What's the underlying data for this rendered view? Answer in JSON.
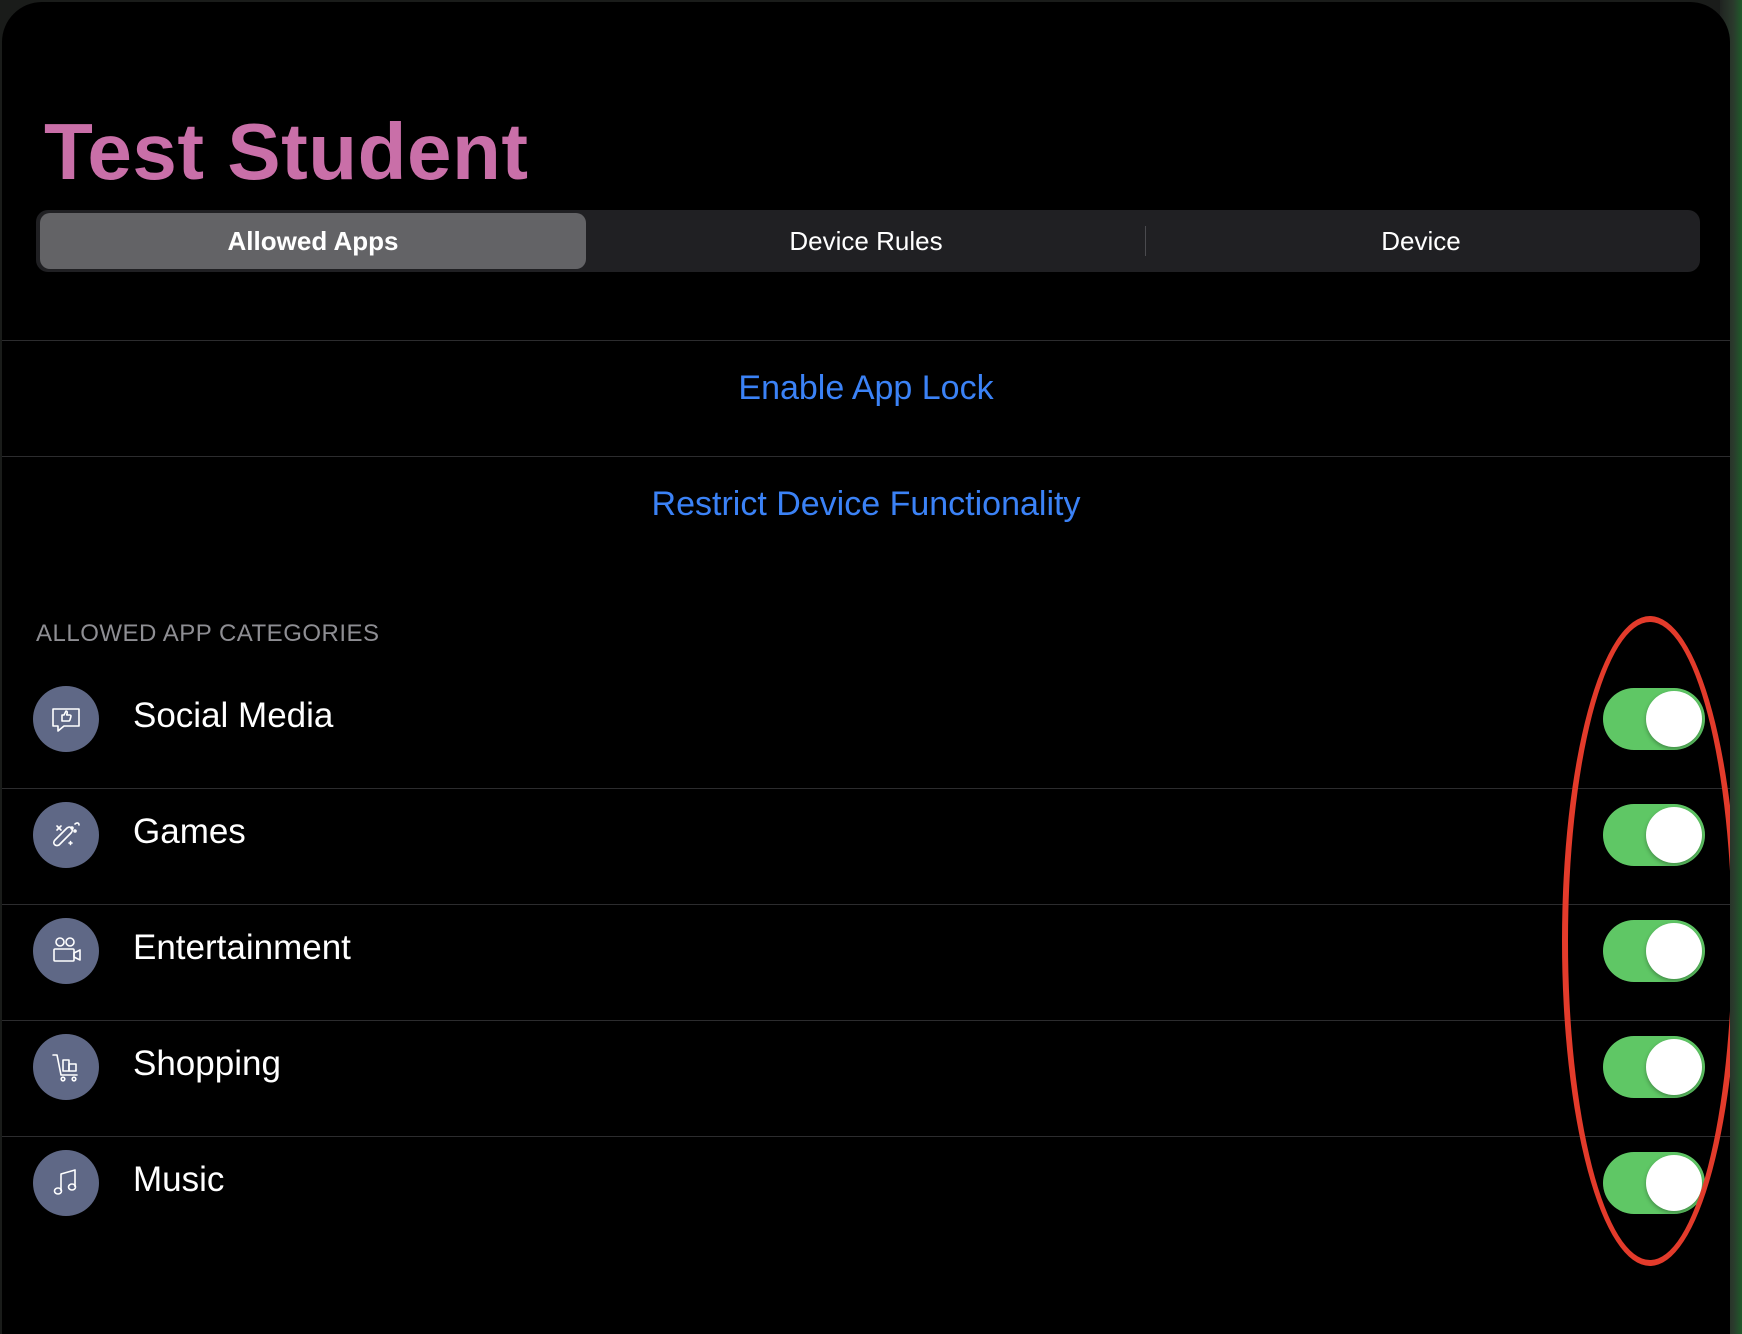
{
  "header": {
    "title": "Test Student"
  },
  "tabs": [
    {
      "label": "Allowed Apps",
      "selected": true
    },
    {
      "label": "Device Rules",
      "selected": false
    },
    {
      "label": "Device",
      "selected": false
    }
  ],
  "actions": {
    "enable_app_lock": "Enable App Lock",
    "restrict_device": "Restrict Device Functionality"
  },
  "categories_section": {
    "header": "ALLOWED APP CATEGORIES",
    "items": [
      {
        "label": "Social Media",
        "icon": "social-media-icon",
        "enabled": true
      },
      {
        "label": "Games",
        "icon": "game-controller-icon",
        "enabled": true
      },
      {
        "label": "Entertainment",
        "icon": "video-camera-icon",
        "enabled": true
      },
      {
        "label": "Shopping",
        "icon": "shopping-cart-icon",
        "enabled": true
      },
      {
        "label": "Music",
        "icon": "music-note-icon",
        "enabled": true
      }
    ]
  },
  "colors": {
    "title": "#c96fa8",
    "link": "#3b82f6",
    "toggle_on": "#5fc765",
    "icon_bg": "#5f6886",
    "annotation": "#e33b2b"
  }
}
